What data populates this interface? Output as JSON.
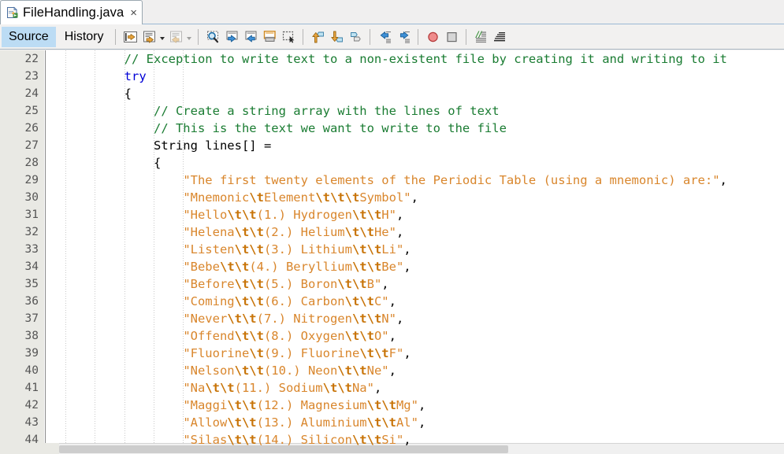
{
  "window": {
    "tab": {
      "icon": "java-file-icon",
      "label": "FileHandling.java",
      "close": "×"
    }
  },
  "view_tabs": [
    {
      "label": "Source",
      "selected": true
    },
    {
      "label": "History",
      "selected": false
    }
  ],
  "toolbar": {
    "groups": [
      {
        "buttons": [
          {
            "name": "last-edit-position-icon",
            "enabled": true,
            "caret": false
          },
          {
            "name": "back-navigation-icon",
            "enabled": true,
            "caret": true
          },
          {
            "name": "forward-navigation-icon",
            "enabled": false,
            "caret": true
          }
        ]
      },
      {
        "buttons": [
          {
            "name": "find-selection-icon",
            "enabled": true,
            "caret": false
          },
          {
            "name": "find-previous-icon",
            "enabled": true,
            "caret": false
          },
          {
            "name": "find-next-icon",
            "enabled": true,
            "caret": false
          },
          {
            "name": "toggle-highlight-search-icon",
            "enabled": true,
            "caret": false
          },
          {
            "name": "toggle-rectangular-selection-icon",
            "enabled": true,
            "caret": false
          }
        ]
      },
      {
        "buttons": [
          {
            "name": "previous-bookmark-icon",
            "enabled": true,
            "caret": false
          },
          {
            "name": "next-bookmark-icon",
            "enabled": true,
            "caret": false
          },
          {
            "name": "toggle-bookmark-icon",
            "enabled": true,
            "caret": false
          }
        ]
      },
      {
        "buttons": [
          {
            "name": "shift-line-left-icon",
            "enabled": true,
            "caret": false
          },
          {
            "name": "shift-line-right-icon",
            "enabled": true,
            "caret": false
          }
        ]
      },
      {
        "buttons": [
          {
            "name": "start-macro-recording-icon",
            "enabled": true,
            "caret": false
          },
          {
            "name": "stop-macro-recording-icon",
            "enabled": true,
            "caret": false
          }
        ]
      },
      {
        "buttons": [
          {
            "name": "toggle-comment-icon",
            "enabled": true,
            "caret": false
          },
          {
            "name": "toggle-non-printable-characters-icon",
            "enabled": true,
            "caret": false
          }
        ]
      }
    ]
  },
  "editor": {
    "first_line": 22,
    "line_height": 22,
    "lines": [
      {
        "number": 22,
        "tokens": [
          {
            "t": "cmt",
            "v": "        // Exception to write text to a non-existent file by creating it and writing to it"
          }
        ]
      },
      {
        "number": 23,
        "tokens": [
          {
            "t": "pln",
            "v": "        "
          },
          {
            "t": "kw",
            "v": "try"
          }
        ]
      },
      {
        "number": 24,
        "tokens": [
          {
            "t": "pln",
            "v": "        {"
          }
        ]
      },
      {
        "number": 25,
        "tokens": [
          {
            "t": "cmt",
            "v": "            // Create a string array with the lines of text"
          }
        ]
      },
      {
        "number": 26,
        "tokens": [
          {
            "t": "cmt",
            "v": "            // This is the text we want to write to the file"
          }
        ]
      },
      {
        "number": 27,
        "tokens": [
          {
            "t": "pln",
            "v": "            String lines[] ="
          }
        ]
      },
      {
        "number": 28,
        "tokens": [
          {
            "t": "pln",
            "v": "            {"
          }
        ]
      },
      {
        "number": 29,
        "tokens": [
          {
            "t": "pln",
            "v": "                "
          },
          {
            "t": "str",
            "v": "\"The first twenty elements of the Periodic Table (using a mnemonic) are:\""
          },
          {
            "t": "pln",
            "v": ","
          }
        ]
      },
      {
        "number": 30,
        "tokens": [
          {
            "t": "pln",
            "v": "                "
          },
          {
            "t": "str",
            "v": "\"Mnemonic"
          },
          {
            "t": "esc",
            "v": "\\t"
          },
          {
            "t": "str",
            "v": "Element"
          },
          {
            "t": "esc",
            "v": "\\t\\t\\t"
          },
          {
            "t": "str",
            "v": "Symbol\""
          },
          {
            "t": "pln",
            "v": ","
          }
        ]
      },
      {
        "number": 31,
        "tokens": [
          {
            "t": "pln",
            "v": "                "
          },
          {
            "t": "str",
            "v": "\"Hello"
          },
          {
            "t": "esc",
            "v": "\\t\\t"
          },
          {
            "t": "str",
            "v": "(1.) Hydrogen"
          },
          {
            "t": "esc",
            "v": "\\t\\t"
          },
          {
            "t": "str",
            "v": "H\""
          },
          {
            "t": "pln",
            "v": ","
          }
        ]
      },
      {
        "number": 32,
        "tokens": [
          {
            "t": "pln",
            "v": "                "
          },
          {
            "t": "str",
            "v": "\"Helena"
          },
          {
            "t": "esc",
            "v": "\\t\\t"
          },
          {
            "t": "str",
            "v": "(2.) Helium"
          },
          {
            "t": "esc",
            "v": "\\t\\t"
          },
          {
            "t": "str",
            "v": "He\""
          },
          {
            "t": "pln",
            "v": ","
          }
        ]
      },
      {
        "number": 33,
        "tokens": [
          {
            "t": "pln",
            "v": "                "
          },
          {
            "t": "str",
            "v": "\"Listen"
          },
          {
            "t": "esc",
            "v": "\\t\\t"
          },
          {
            "t": "str",
            "v": "(3.) Lithium"
          },
          {
            "t": "esc",
            "v": "\\t\\t"
          },
          {
            "t": "str",
            "v": "Li\""
          },
          {
            "t": "pln",
            "v": ","
          }
        ]
      },
      {
        "number": 34,
        "tokens": [
          {
            "t": "pln",
            "v": "                "
          },
          {
            "t": "str",
            "v": "\"Bebe"
          },
          {
            "t": "esc",
            "v": "\\t\\t"
          },
          {
            "t": "str",
            "v": "(4.) Beryllium"
          },
          {
            "t": "esc",
            "v": "\\t\\t"
          },
          {
            "t": "str",
            "v": "Be\""
          },
          {
            "t": "pln",
            "v": ","
          }
        ]
      },
      {
        "number": 35,
        "tokens": [
          {
            "t": "pln",
            "v": "                "
          },
          {
            "t": "str",
            "v": "\"Before"
          },
          {
            "t": "esc",
            "v": "\\t\\t"
          },
          {
            "t": "str",
            "v": "(5.) Boron"
          },
          {
            "t": "esc",
            "v": "\\t\\t"
          },
          {
            "t": "str",
            "v": "B\""
          },
          {
            "t": "pln",
            "v": ","
          }
        ]
      },
      {
        "number": 36,
        "tokens": [
          {
            "t": "pln",
            "v": "                "
          },
          {
            "t": "str",
            "v": "\"Coming"
          },
          {
            "t": "esc",
            "v": "\\t\\t"
          },
          {
            "t": "str",
            "v": "(6.) Carbon"
          },
          {
            "t": "esc",
            "v": "\\t\\t"
          },
          {
            "t": "str",
            "v": "C\""
          },
          {
            "t": "pln",
            "v": ","
          }
        ]
      },
      {
        "number": 37,
        "tokens": [
          {
            "t": "pln",
            "v": "                "
          },
          {
            "t": "str",
            "v": "\"Never"
          },
          {
            "t": "esc",
            "v": "\\t\\t"
          },
          {
            "t": "str",
            "v": "(7.) Nitrogen"
          },
          {
            "t": "esc",
            "v": "\\t\\t"
          },
          {
            "t": "str",
            "v": "N\""
          },
          {
            "t": "pln",
            "v": ","
          }
        ]
      },
      {
        "number": 38,
        "tokens": [
          {
            "t": "pln",
            "v": "                "
          },
          {
            "t": "str",
            "v": "\"Offend"
          },
          {
            "t": "esc",
            "v": "\\t\\t"
          },
          {
            "t": "str",
            "v": "(8.) Oxygen"
          },
          {
            "t": "esc",
            "v": "\\t\\t"
          },
          {
            "t": "str",
            "v": "O\""
          },
          {
            "t": "pln",
            "v": ","
          }
        ]
      },
      {
        "number": 39,
        "tokens": [
          {
            "t": "pln",
            "v": "                "
          },
          {
            "t": "str",
            "v": "\"Fluorine"
          },
          {
            "t": "esc",
            "v": "\\t"
          },
          {
            "t": "str",
            "v": "(9.) Fluorine"
          },
          {
            "t": "esc",
            "v": "\\t\\t"
          },
          {
            "t": "str",
            "v": "F\""
          },
          {
            "t": "pln",
            "v": ","
          }
        ]
      },
      {
        "number": 40,
        "tokens": [
          {
            "t": "pln",
            "v": "                "
          },
          {
            "t": "str",
            "v": "\"Nelson"
          },
          {
            "t": "esc",
            "v": "\\t\\t"
          },
          {
            "t": "str",
            "v": "(10.) Neon"
          },
          {
            "t": "esc",
            "v": "\\t\\t"
          },
          {
            "t": "str",
            "v": "Ne\""
          },
          {
            "t": "pln",
            "v": ","
          }
        ]
      },
      {
        "number": 41,
        "tokens": [
          {
            "t": "pln",
            "v": "                "
          },
          {
            "t": "str",
            "v": "\"Na"
          },
          {
            "t": "esc",
            "v": "\\t\\t"
          },
          {
            "t": "str",
            "v": "(11.) Sodium"
          },
          {
            "t": "esc",
            "v": "\\t\\t"
          },
          {
            "t": "str",
            "v": "Na\""
          },
          {
            "t": "pln",
            "v": ","
          }
        ]
      },
      {
        "number": 42,
        "tokens": [
          {
            "t": "pln",
            "v": "                "
          },
          {
            "t": "str",
            "v": "\"Maggi"
          },
          {
            "t": "esc",
            "v": "\\t\\t"
          },
          {
            "t": "str",
            "v": "(12.) Magnesium"
          },
          {
            "t": "esc",
            "v": "\\t\\t"
          },
          {
            "t": "str",
            "v": "Mg\""
          },
          {
            "t": "pln",
            "v": ","
          }
        ]
      },
      {
        "number": 43,
        "tokens": [
          {
            "t": "pln",
            "v": "                "
          },
          {
            "t": "str",
            "v": "\"Allow"
          },
          {
            "t": "esc",
            "v": "\\t\\t"
          },
          {
            "t": "str",
            "v": "(13.) Aluminium"
          },
          {
            "t": "esc",
            "v": "\\t\\t"
          },
          {
            "t": "str",
            "v": "Al\""
          },
          {
            "t": "pln",
            "v": ","
          }
        ]
      },
      {
        "number": 44,
        "tokens": [
          {
            "t": "pln",
            "v": "                "
          },
          {
            "t": "str",
            "v": "\"Silas"
          },
          {
            "t": "esc",
            "v": "\\t\\t"
          },
          {
            "t": "str",
            "v": "(14.) Silicon"
          },
          {
            "t": "esc",
            "v": "\\t\\t"
          },
          {
            "t": "str",
            "v": "Si\""
          },
          {
            "t": "pln",
            "v": ","
          }
        ]
      }
    ],
    "indent_guide_columns": [
      0,
      4,
      8,
      12,
      16
    ],
    "colors": {
      "comment": "#1a7c32",
      "keyword": "#0000d6",
      "string": "#d9862c",
      "escape": "#c87408",
      "plain": "#000000",
      "gutter_bg": "#e9e9e4",
      "editor_bg": "#ffffff",
      "selected_tab_bg": "#bcdcf4"
    }
  },
  "scrollbar": {
    "orientation": "horizontal",
    "thumb_fraction": 0.62
  }
}
